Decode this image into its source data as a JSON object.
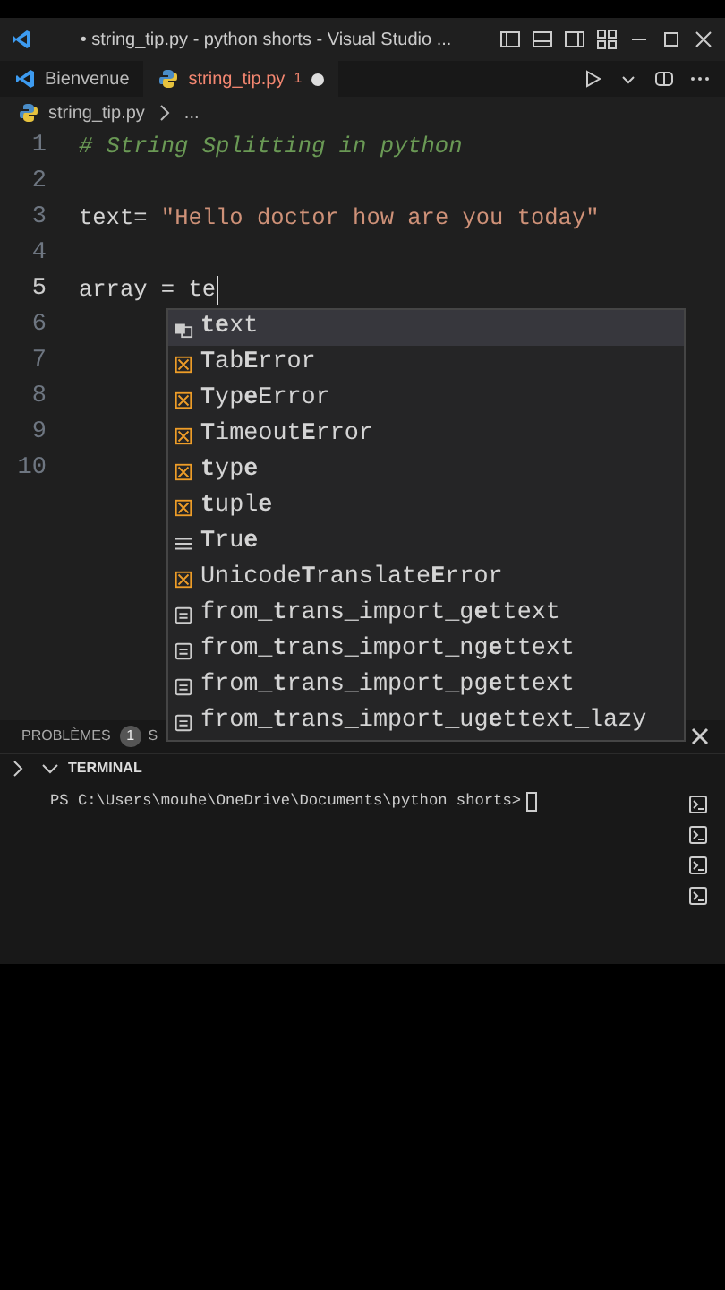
{
  "window": {
    "title": "• string_tip.py - python shorts - Visual Studio ..."
  },
  "tabs": [
    {
      "label": "Bienvenue",
      "kind": "welcome",
      "selected": false
    },
    {
      "label": "string_tip.py",
      "kind": "python",
      "selected": true,
      "problems": "1",
      "dirty": true
    }
  ],
  "breadcrumb": [
    "string_tip.py",
    "..."
  ],
  "code_lines": [
    {
      "number": "1",
      "tokens": [
        {
          "kind": "comment",
          "text": "# String Splitting in python"
        }
      ]
    },
    {
      "number": "2"
    },
    {
      "number": "3",
      "tokens": [
        {
          "kind": "plain",
          "text": "text= "
        },
        {
          "kind": "string",
          "text": "\"Hello doctor how are you today\""
        }
      ]
    },
    {
      "number": "4"
    },
    {
      "number": "5",
      "current": true,
      "tokens": [
        {
          "kind": "plain",
          "text": "array = te"
        }
      ]
    },
    {
      "number": "6"
    },
    {
      "number": "7"
    },
    {
      "number": "8"
    },
    {
      "number": "9"
    },
    {
      "number": "10"
    }
  ],
  "suggestions": [
    {
      "label": "**te**xt",
      "kind": "variable",
      "selected": true
    },
    {
      "label": "**T**ab**E**rror",
      "kind": "class",
      "selected": false
    },
    {
      "label": "**T**yp**e**Error",
      "kind": "class",
      "selected": false
    },
    {
      "label": "**T**imeout**E**rror",
      "kind": "class",
      "selected": false
    },
    {
      "label": "**t**yp**e**",
      "kind": "class",
      "selected": false
    },
    {
      "label": "**t**upl**e**",
      "kind": "class",
      "selected": false
    },
    {
      "label": "**T**ru**e**",
      "kind": "keyword",
      "selected": false
    },
    {
      "label": "Unicode**T**ranslate**E**rror",
      "kind": "class",
      "selected": false
    },
    {
      "label": "from_**t**rans_import_g**e**ttext",
      "kind": "module",
      "selected": false
    },
    {
      "label": "from_**t**rans_import_ng**e**ttext",
      "kind": "module",
      "selected": false
    },
    {
      "label": "from_**t**rans_import_pg**e**ttext",
      "kind": "module",
      "selected": false
    },
    {
      "label": "from_**t**rans_import_ug**e**ttext_lazy",
      "kind": "module",
      "selected": false
    }
  ],
  "panel": {
    "tabs": [
      {
        "label": "PROBLÈMES",
        "count": "1",
        "selected": false
      },
      {
        "label": "S",
        "selected": false
      }
    ],
    "section": "TERMINAL",
    "prompt": "PS C:\\Users\\mouhe\\OneDrive\\Documents\\python shorts>"
  }
}
